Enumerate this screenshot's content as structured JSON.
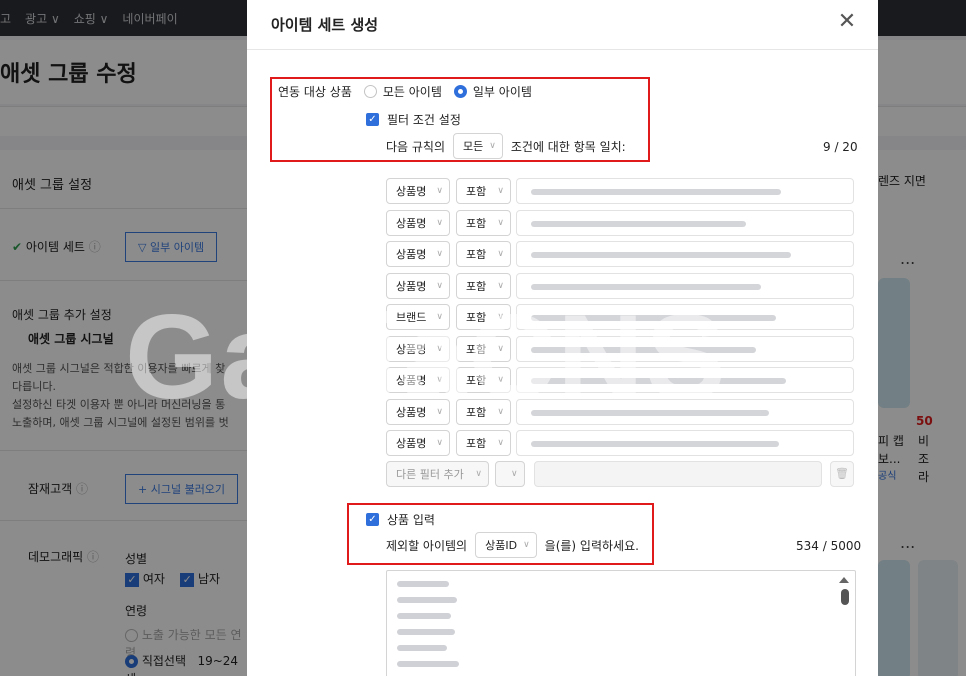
{
  "background": {
    "topbar_items": [
      "고",
      "광고 ∨",
      "쇼핑 ∨",
      "네이버페이"
    ],
    "page_title": "애셋 그룹 수정",
    "section_title": "애셋 그룹 설정",
    "item_set_label": "아이템 세트",
    "item_set_button": "일부 아이템",
    "add_settings_title": "애셋 그룹 추가 설정",
    "signal_title": "애셋 그룹 시그널",
    "signal_desc_1": "애셋 그룹 시그널은 적합한 이용자를 빠르게 찾",
    "signal_desc_2": "다릅니다.",
    "signal_desc_3": "설정하신 타겟 이용자 뿐 아니라 머신러닝을 통",
    "signal_desc_4": "노출하며, 애셋 그룹 시그널에 설정된 범위를 벗",
    "prospect_label": "잠재고객",
    "prospect_button": "+ 시그널 불러오기",
    "demographic_label": "데모그래픽",
    "gender_label": "성별",
    "gender_female": "여자",
    "gender_male": "남자",
    "age_label": "연령",
    "age_all": "노출 가능한 모든 연령",
    "age_direct": "직접선택",
    "age_range": "19~24세",
    "right_text_1": "렌즈 지면",
    "right_text_2": "피 캡",
    "right_text_3": "보...",
    "right_text_4": "비",
    "right_text_5": "조",
    "right_text_6": "라",
    "right_num": "50",
    "right_badge": "공식",
    "right_ellipsis": "..."
  },
  "modal": {
    "title": "아이템 세트 생성",
    "target_label": "연동 대상 상품",
    "option_all": "모든 아이템",
    "option_some": "일부 아이템",
    "filter_checkbox_label": "필터 조건 설정",
    "rule_prefix": "다음 규칙의",
    "rule_select": "모든",
    "rule_suffix": "조건에 대한 항목 일치:",
    "filter_count": "9 / 20",
    "filters": [
      {
        "field": "상품명",
        "op": "포함"
      },
      {
        "field": "상품명",
        "op": "포함"
      },
      {
        "field": "상품명",
        "op": "포함"
      },
      {
        "field": "상품명",
        "op": "포함"
      },
      {
        "field": "브랜드",
        "op": "포함"
      },
      {
        "field": "상품명",
        "op": "포함"
      },
      {
        "field": "상품명",
        "op": "포함"
      },
      {
        "field": "상품명",
        "op": "포함"
      },
      {
        "field": "상품명",
        "op": "포함"
      }
    ],
    "add_filter_label": "다른 필터 추가",
    "product_input_label": "상품 입력",
    "exclude_prefix": "제외할 아이템의",
    "exclude_select": "상품ID",
    "exclude_suffix": "을(를) 입력하세요.",
    "product_count": "534 / 5000"
  },
  "watermark": "GabiaCNS",
  "colors": {
    "accent": "#2f6fdb",
    "highlight": "#e01a1a",
    "overlay": "rgba(0,0,0,0.45)"
  }
}
